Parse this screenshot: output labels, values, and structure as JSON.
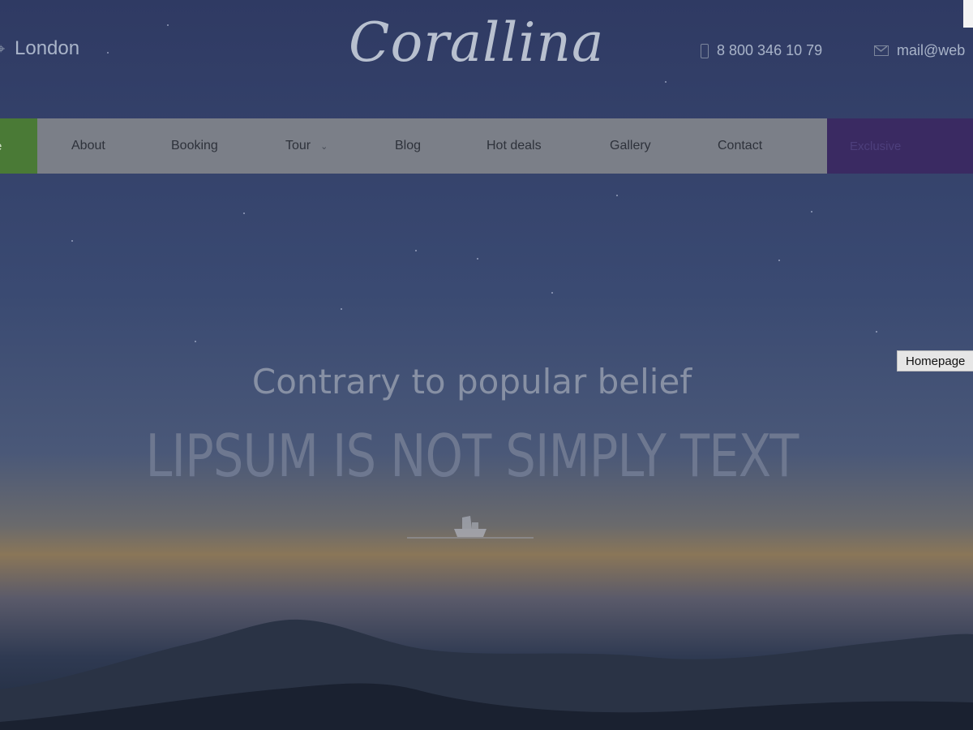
{
  "topbar": {
    "city": "London",
    "logo": "Corallina",
    "phone": "8 800 346 10 79",
    "email": "mail@web"
  },
  "nav": {
    "home_label": "e",
    "items": [
      {
        "label": "About"
      },
      {
        "label": "Booking"
      },
      {
        "label": "Tour"
      },
      {
        "label": "Blog"
      },
      {
        "label": "Hot deals"
      },
      {
        "label": "Gallery"
      },
      {
        "label": "Contact"
      }
    ],
    "cta_label": "Exclusive"
  },
  "hero": {
    "subtitle": "Contrary to popular belief",
    "title": "LIPSUM IS NOT SIMPLY TEXT"
  },
  "tooltip": "Homepage",
  "colors": {
    "home_accent": "#4a7a36",
    "cta_accent": "#3a2a62",
    "navbar_bg": "#7b7f88"
  },
  "icons": {
    "city": "map-pin-icon",
    "phone": "phone-icon",
    "email": "envelope-icon",
    "tour_caret": "chevron-down-icon",
    "divider": "boat-icon"
  }
}
